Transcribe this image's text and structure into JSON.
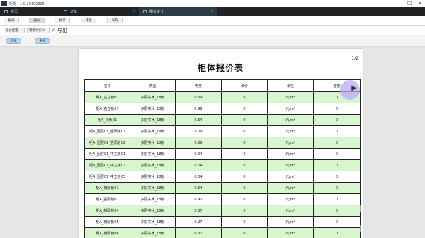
{
  "window": {
    "title": "柜帽 - 1.0.20190305",
    "minimize": "—",
    "maximize": "☐",
    "close": "✕"
  },
  "tabs": [
    {
      "label": "首页",
      "active": false
    },
    {
      "label": "订单",
      "active": false
    },
    {
      "label": "报价设计",
      "active": true
    }
  ],
  "toolbar1": {
    "buttons": [
      "报纸",
      "报价",
      "拆单",
      "排版",
      "采购"
    ]
  },
  "toolbar2": {
    "settings_label": "报价配置",
    "quote_select_label": "销售计价 V",
    "export_label": "导出"
  },
  "toolbar3": {
    "pills": [
      "柜体",
      "五金"
    ]
  },
  "document": {
    "page_number": "1/2",
    "title": "柜体报价表",
    "columns": [
      "名称",
      "类型",
      "用量",
      "单价",
      "单位",
      "金额"
    ],
    "rows": [
      [
        "柜A_左立板01",
        "多层实木_18板",
        "0.59",
        "0",
        "元/m²",
        "0"
      ],
      [
        "柜A_右立板01",
        "多层实木_18板",
        "0.99",
        "0",
        "元/m²",
        "0"
      ],
      [
        "柜A_顶板01",
        "多层实木_18板",
        "0.64",
        "0",
        "元/m²",
        "0"
      ],
      [
        "柜A_固层01_竖隔板01",
        "多层实木_18板",
        "0.09",
        "0",
        "元/m²",
        "0"
      ],
      [
        "柜A_固层01_竖隔板02",
        "多层实木_18板",
        "0.09",
        "0",
        "元/m²",
        "0"
      ],
      [
        "柜A_固层01_中立板01",
        "多层实木_18板",
        "0.04",
        "0",
        "元/m²",
        "0"
      ],
      [
        "柜A_固层01_中立板02",
        "多层实木_18板",
        "0.04",
        "0",
        "元/m²",
        "0"
      ],
      [
        "柜A_固层01_中立板03",
        "多层实木_18板",
        "0.04",
        "0",
        "元/m²",
        "0"
      ],
      [
        "柜A_横隔板01",
        "多层实木_18板",
        "0.64",
        "0",
        "元/m²",
        "0"
      ],
      [
        "柜A_竖隔板01",
        "多层实木_18板",
        "0.92",
        "0",
        "元/m²",
        "0"
      ],
      [
        "柜A_横隔板04",
        "多层实木_18板",
        "0.37",
        "0",
        "元/m²",
        "0"
      ],
      [
        "柜A_横隔板05",
        "多层实木_18板",
        "0.27",
        "0",
        "元/m²",
        "0"
      ],
      [
        "柜A_横隔板06",
        "多层实木_18板",
        "0.37",
        "0",
        "元/m²",
        "0"
      ]
    ]
  },
  "colors": {
    "row_green": "#d8f5cf",
    "tabbar_bg": "#1f2326",
    "pill_blue": "#b8d4ef"
  }
}
